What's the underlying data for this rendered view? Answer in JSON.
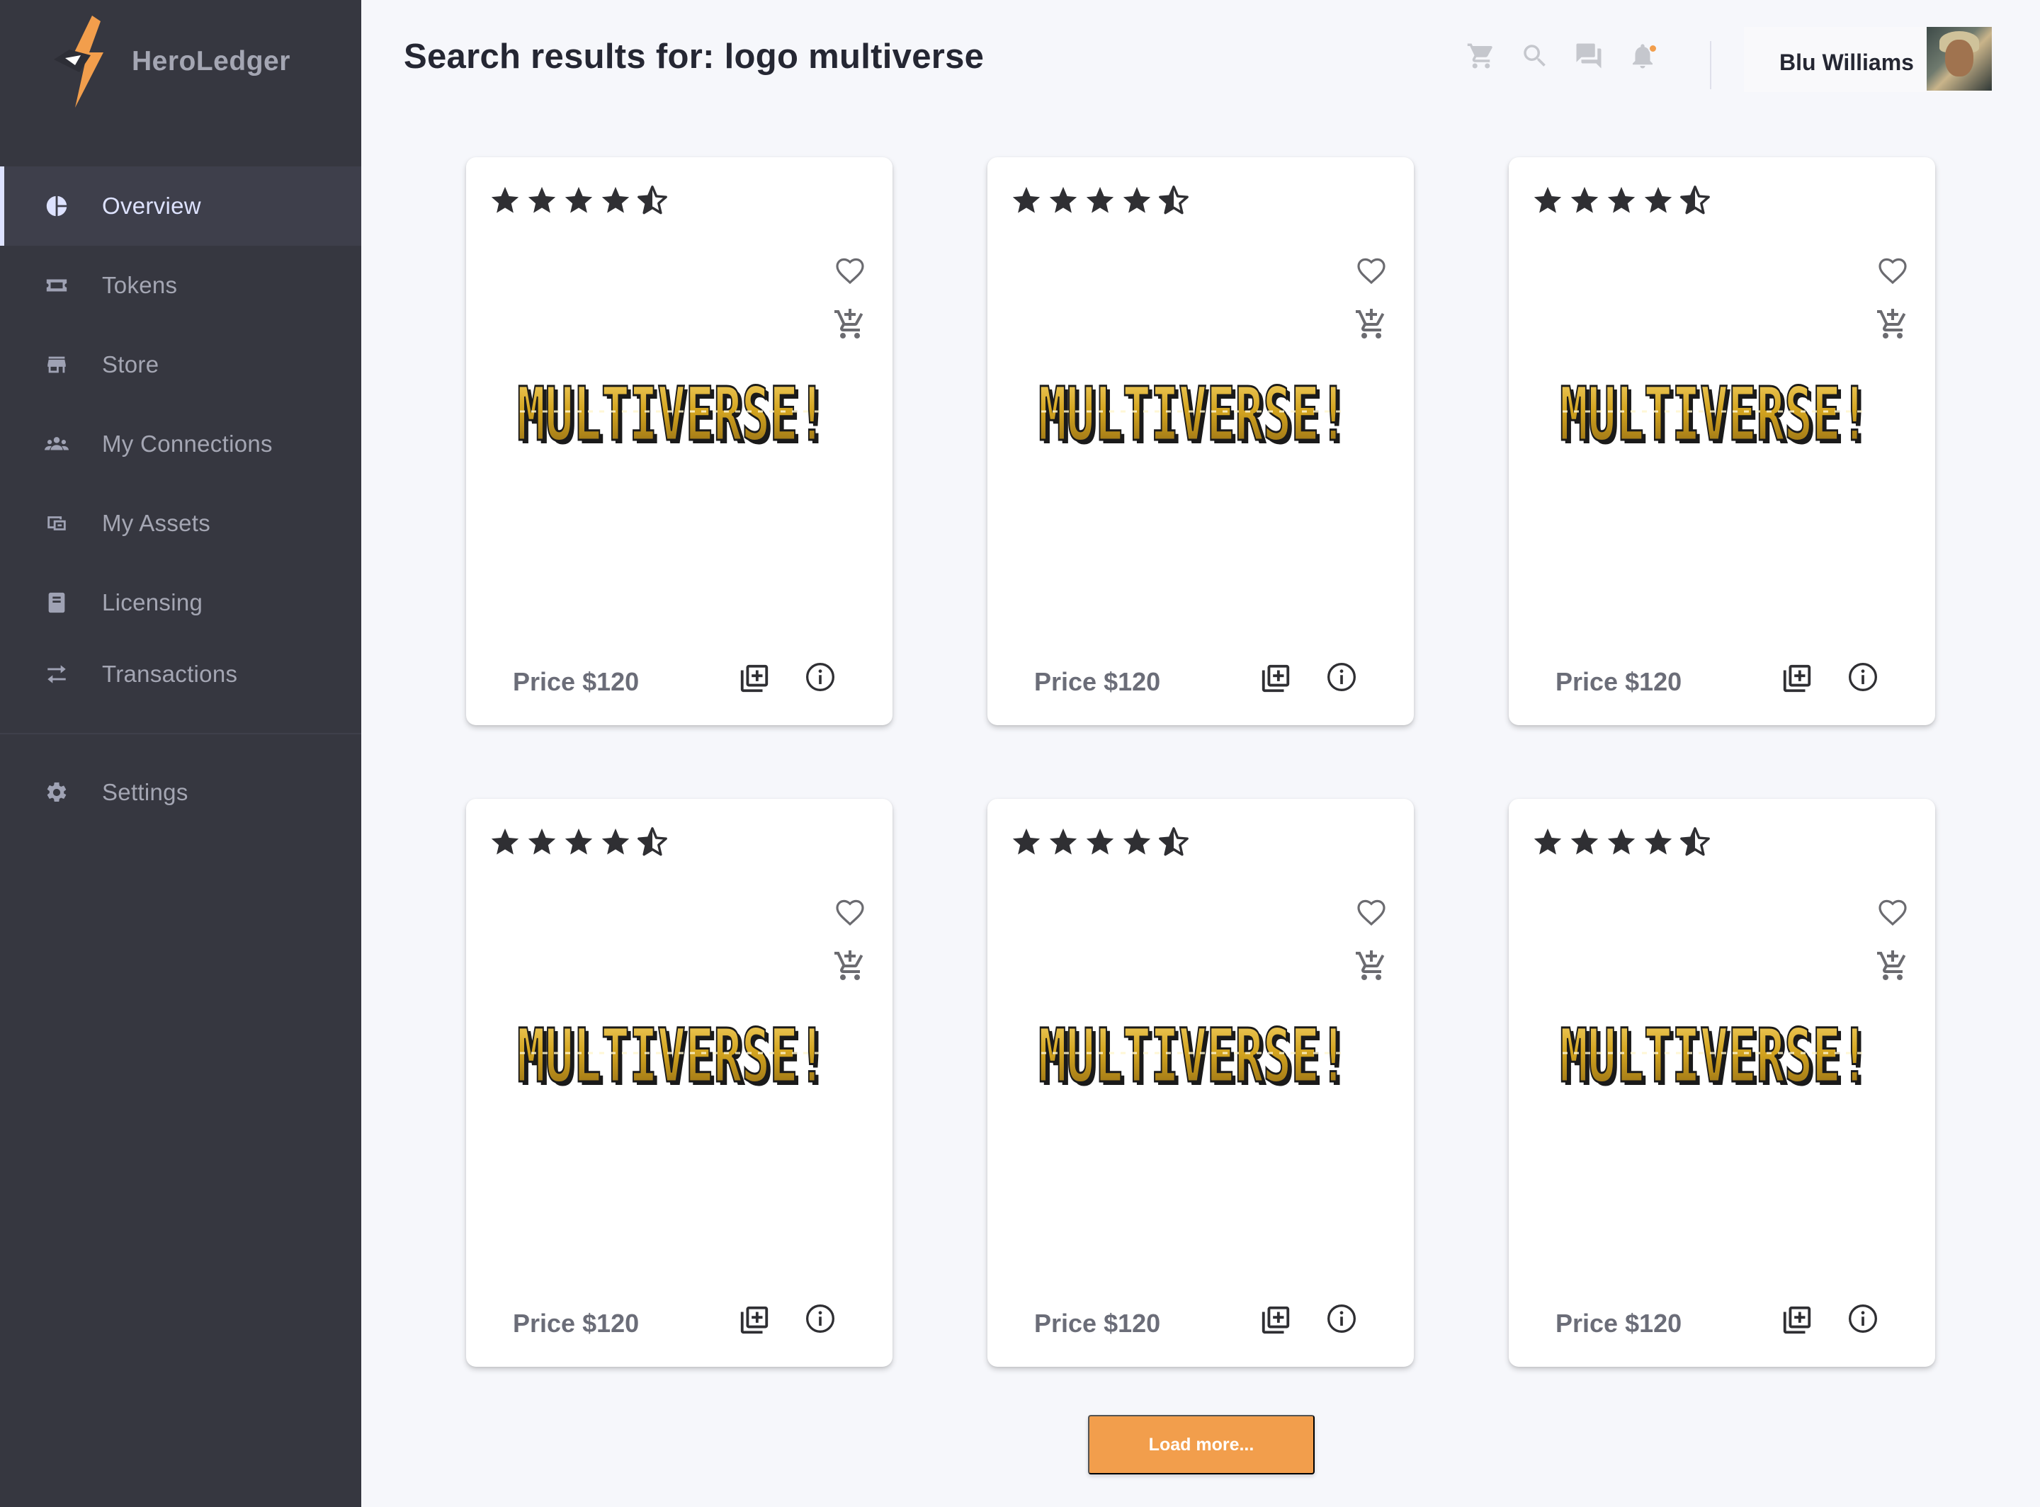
{
  "brand": {
    "name": "HeroLedger"
  },
  "sidebar": {
    "items": [
      {
        "label": "Overview",
        "icon": "pie-chart-icon",
        "active": true
      },
      {
        "label": "Tokens",
        "icon": "ticket-icon"
      },
      {
        "label": "Store",
        "icon": "store-icon"
      },
      {
        "label": "My Connections",
        "icon": "people-icon"
      },
      {
        "label": "My Assets",
        "icon": "assets-icon"
      },
      {
        "label": "Licensing",
        "icon": "book-icon"
      },
      {
        "label": "Transactions",
        "icon": "swap-arrows-icon"
      }
    ],
    "settings": {
      "label": "Settings",
      "icon": "gear-icon"
    }
  },
  "header": {
    "title": "Search results for: logo multiverse",
    "icons": [
      "cart-icon",
      "search-icon",
      "chat-icon",
      "bell-icon"
    ],
    "user": {
      "name": "Blu Williams"
    }
  },
  "results": [
    {
      "rating": 4.5,
      "logo_text": "MULTIVERSE!",
      "price": "Price $120"
    },
    {
      "rating": 4.5,
      "logo_text": "MULTIVERSE!",
      "price": "Price $120"
    },
    {
      "rating": 4.5,
      "logo_text": "MULTIVERSE!",
      "price": "Price $120"
    },
    {
      "rating": 4.5,
      "logo_text": "MULTIVERSE!",
      "price": "Price $120"
    },
    {
      "rating": 4.5,
      "logo_text": "MULTIVERSE!",
      "price": "Price $120"
    },
    {
      "rating": 4.5,
      "logo_text": "MULTIVERSE!",
      "price": "Price $120"
    }
  ],
  "load_more": {
    "label": "Load more..."
  },
  "colors": {
    "sidebar": "#363740",
    "accent": "#f29e4c",
    "logo_gold": "#d4a520",
    "background": "#f6f7fb"
  }
}
